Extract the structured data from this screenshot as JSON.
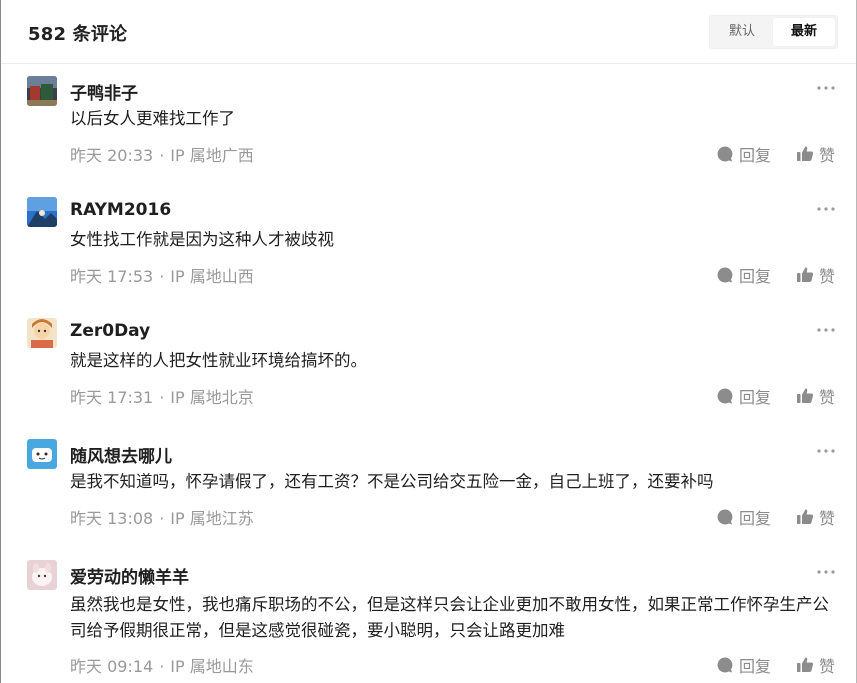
{
  "header": {
    "title": "582 条评论",
    "sort_default": "默认",
    "sort_newest": "最新"
  },
  "comments": [
    {
      "username": "子鸭非子",
      "text": "以后女人更难找工作了",
      "time": "昨天 20:33",
      "ip": "IP 属地广西",
      "reply_label": "回复",
      "like_label": "赞"
    },
    {
      "username": "RAYM2016",
      "text": "女性找工作就是因为这种人才被歧视",
      "time": "昨天 17:53",
      "ip": "IP 属地山西",
      "reply_label": "回复",
      "like_label": "赞"
    },
    {
      "username": "Zer0Day",
      "text": "就是这样的人把女性就业环境给搞坏的。",
      "time": "昨天 17:31",
      "ip": "IP 属地北京",
      "reply_label": "回复",
      "like_label": "赞"
    },
    {
      "username": "随风想去哪儿",
      "text": "是我不知道吗，怀孕请假了，还有工资？不是公司给交五险一金，自己上班了，还要补吗",
      "time": "昨天 13:08",
      "ip": "IP 属地江苏",
      "reply_label": "回复",
      "like_label": "赞"
    },
    {
      "username": "爱劳动的懒羊羊",
      "text": "虽然我也是女性，我也痛斥职场的不公，但是这样只会让企业更加不敢用女性，如果正常工作怀孕生产公司给予假期很正常，但是这感觉很碰瓷，要小聪明，只会让路更加难",
      "time": "昨天 09:14",
      "ip": "IP 属地山东",
      "reply_label": "回复",
      "like_label": "赞"
    }
  ],
  "separator": "·",
  "colors": {
    "accent": "#1f1f1f",
    "meta": "#9a9a9a",
    "action": "#8c8c8c"
  },
  "icons": {
    "more": "more-icon",
    "reply": "comment-bubble-icon",
    "like": "thumbs-up-icon"
  }
}
